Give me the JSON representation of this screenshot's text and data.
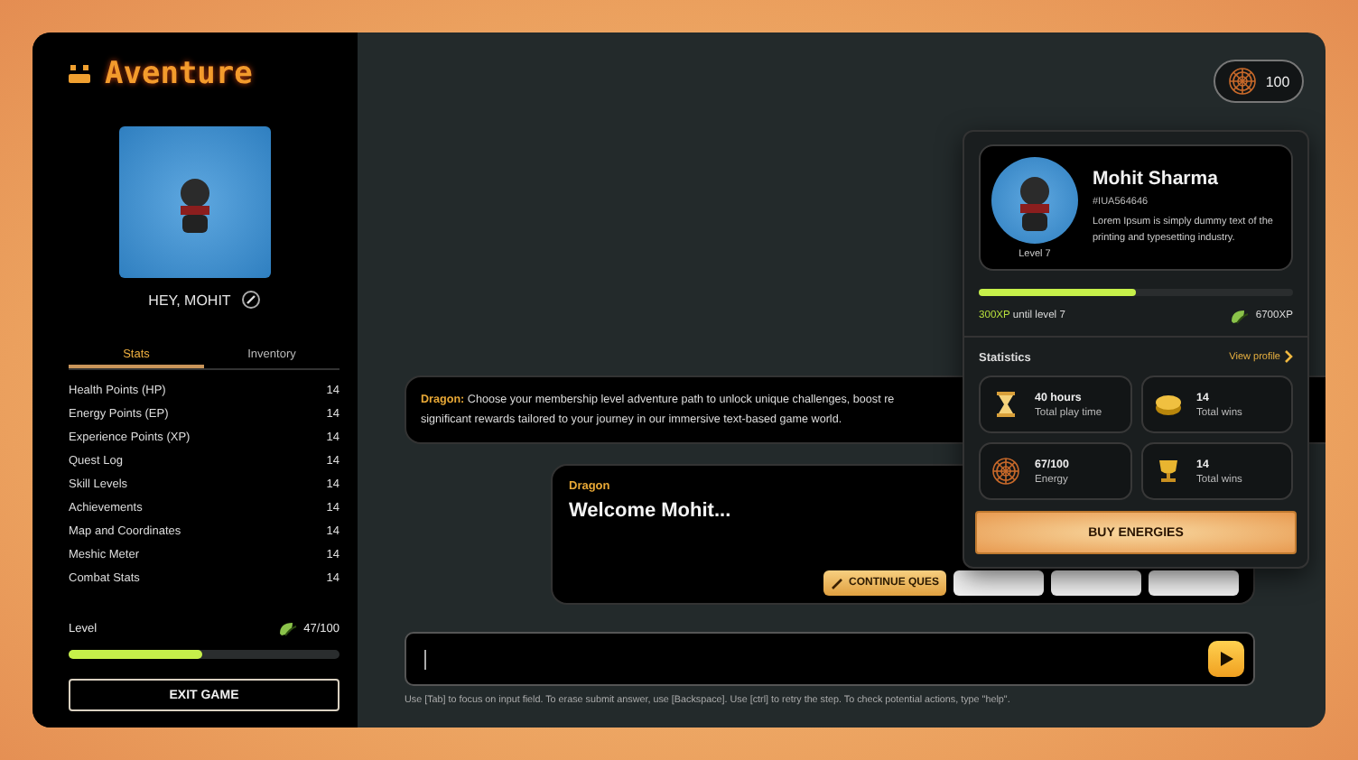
{
  "app": {
    "logo": "Aventure"
  },
  "sidebar": {
    "greeting": "HEY, MOHIT",
    "tabs": [
      {
        "label": "Stats",
        "selected": true
      },
      {
        "label": "Inventory",
        "selected": false
      }
    ],
    "stats": [
      {
        "name": "Health Points (HP)",
        "value": "14"
      },
      {
        "name": "Energy Points (EP)",
        "value": "14"
      },
      {
        "name": "Experience Points (XP)",
        "value": "14"
      },
      {
        "name": "Quest Log",
        "value": "14"
      },
      {
        "name": "Skill Levels",
        "value": "14"
      },
      {
        "name": "Achievements",
        "value": "14"
      },
      {
        "name": "Map and Coordinates",
        "value": "14"
      },
      {
        "name": "Meshic Meter",
        "value": "14"
      },
      {
        "name": "Combat Stats",
        "value": "14"
      }
    ],
    "level": {
      "label": "Level",
      "reading": "47/100",
      "level": 0.49
    },
    "exit_button": "EXIT GAME"
  },
  "chat": {
    "messages": [
      {
        "kind": "inline",
        "speaker": "Dragon:",
        "lines": [
          "Choose your membership level adventure path to unlock unique challenges, boost re",
          "significant rewards tailored to your journey in our immersive text-based game world."
        ]
      },
      {
        "kind": "card",
        "speaker": "Dragon",
        "text": "Welcome Mohit...",
        "actions": [
          {
            "kind": "primary",
            "label": "CONTINUE QUES"
          },
          {
            "kind": "secondary"
          },
          {
            "kind": "secondary"
          },
          {
            "kind": "secondary"
          }
        ]
      }
    ],
    "input": {
      "hint": "Use [Tab] to focus on input field. To erase submit answer, use [Backspace]. Use [ctrl] to retry the step. To check potential actions, type \"help\"."
    }
  },
  "energy_chip": {
    "value": "100"
  },
  "profile_popup": {
    "name": "Mohit Sharma",
    "id": "#IUA564646",
    "bio": "Lorem Ipsum is simply dummy text of the printing and typesetting industry.",
    "avatar_caption": "Level 7",
    "xp": {
      "level": 0.5,
      "needed": "300XP",
      "until": "until level 7",
      "total": "6700XP"
    },
    "statistics_title": "Statistics",
    "view_profile": "View profile",
    "stats": [
      {
        "kind": "hourglass",
        "value": "40 hours",
        "label": "Total play time"
      },
      {
        "kind": "coin",
        "value": "14",
        "label": "Total wins"
      },
      {
        "kind": "web",
        "value": "67/100",
        "label": "Energy"
      },
      {
        "kind": "trophy",
        "value": "14",
        "label": "Total wins"
      }
    ],
    "buy_button": "BUY ENERGIES"
  }
}
